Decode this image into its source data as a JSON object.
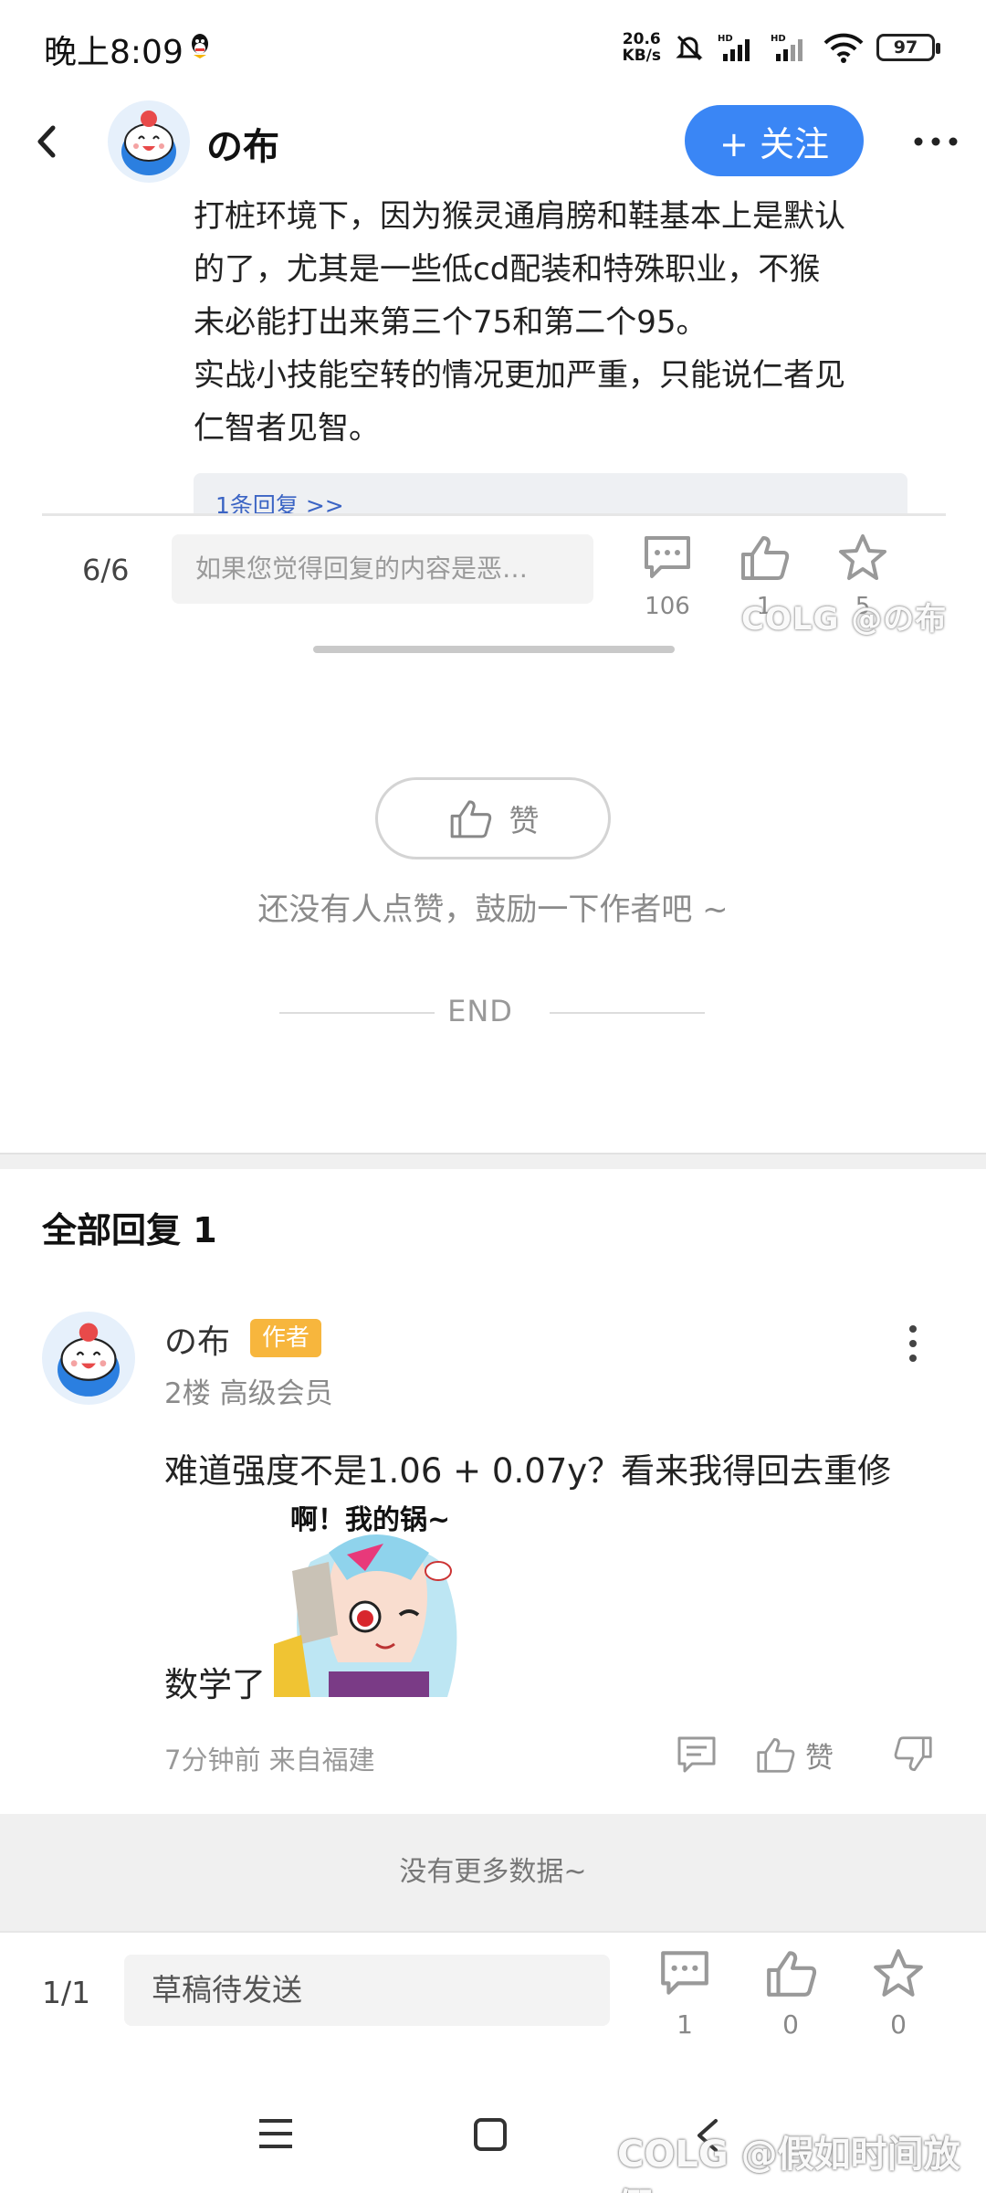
{
  "status_bar": {
    "time": "晚上8:09",
    "net_speed_value": "20.6",
    "net_speed_unit": "KB/s",
    "battery": "97"
  },
  "header": {
    "name": "の布",
    "follow_label": "+ 关注"
  },
  "post": {
    "lines": [
      "打桩环境下，因为猴灵通肩膀和鞋基本上是默认",
      "的了，尤其是一些低cd配装和特殊职业，不猴",
      "未必能打出来第三个75和第二个95。",
      "实战小技能空转的情况更加严重，只能说仁者见",
      "仁智者见智。"
    ],
    "reply_link": "1条回复 >>"
  },
  "inner_bar": {
    "page": "6/6",
    "input_placeholder": "如果您觉得回复的内容是恶…",
    "comment_count": "106",
    "like_count": "1",
    "star_count": "5",
    "watermark": "COLG @の布"
  },
  "like_section": {
    "like_label": "赞",
    "hint": "还没有人点赞，鼓励一下作者吧 ~",
    "end_label": "END"
  },
  "replies": {
    "header": "全部回复 1",
    "items": [
      {
        "name": "の布",
        "badge": "作者",
        "meta": "2楼 高级会员",
        "text_line1": "难道强度不是1.06 + 0.07y？看来我得回去重修",
        "sticker_text": "啊！我的锅~",
        "text_line2": "数学了",
        "time": "7分钟前 来自福建",
        "like_label": "赞"
      }
    ],
    "no_more": "没有更多数据~"
  },
  "bottom_bar": {
    "page": "1/1",
    "draft_label": "草稿待发送",
    "comment_count": "1",
    "like_count": "0",
    "star_count": "0"
  },
  "watermark": "COLG @假如时间放假",
  "colors": {
    "accent": "#3a86f5",
    "author_badge": "#f7b63d",
    "link": "#3b64c4"
  }
}
